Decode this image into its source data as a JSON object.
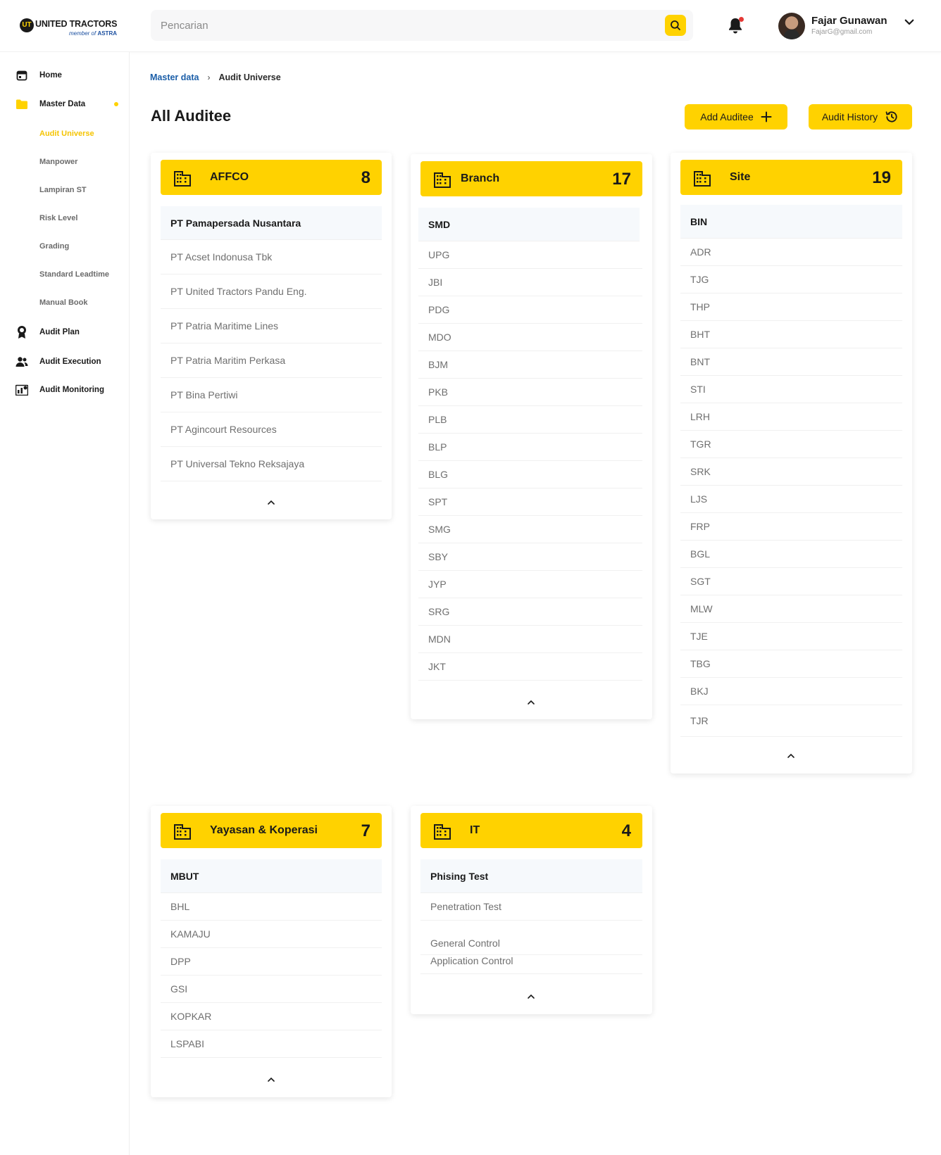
{
  "brand": {
    "badge": "UT",
    "name": "UNITED TRACTORS",
    "tagline_prefix": "member of",
    "tagline_brand": "ASTRA"
  },
  "search": {
    "placeholder": "Pencarian",
    "value": ""
  },
  "user": {
    "name": "Fajar Gunawan",
    "email": "FajarG@gmail.com"
  },
  "sidebar": {
    "items": [
      {
        "label": "Home",
        "icon": "calendar-icon"
      },
      {
        "label": "Master Data",
        "icon": "folder-icon"
      },
      {
        "label": "Audit Plan",
        "icon": "award-ribbon-icon"
      },
      {
        "label": "Audit Execution",
        "icon": "users-icon"
      },
      {
        "label": "Audit Monitoring",
        "icon": "monitoring-chart-icon"
      }
    ],
    "sub_items": [
      {
        "label": "Audit Universe",
        "active": true
      },
      {
        "label": "Manpower"
      },
      {
        "label": "Lampiran ST"
      },
      {
        "label": "Risk Level"
      },
      {
        "label": "Grading"
      },
      {
        "label": "Standard Leadtime"
      },
      {
        "label": "Manual Book"
      }
    ]
  },
  "breadcrumb": {
    "parent": "Master data",
    "separator": "›",
    "current": "Audit Universe"
  },
  "page": {
    "title": "All Auditee",
    "add_button": "Add Auditee",
    "history_button": "Audit History"
  },
  "cards": [
    {
      "title": "AFFCO",
      "count": "8",
      "items": [
        "PT Pamapersada Nusantara",
        "PT Acset Indonusa Tbk",
        "PT United Tractors Pandu Eng.",
        "PT Patria Maritime Lines",
        "PT Patria Maritim Perkasa",
        "PT Bina Pertiwi",
        "PT Agincourt Resources",
        "PT Universal Tekno Reksajaya"
      ]
    },
    {
      "title": "Branch",
      "count": "17",
      "items": [
        "SMD",
        "UPG",
        "JBI",
        "PDG",
        "MDO",
        "BJM",
        "PKB",
        "PLB",
        "BLP",
        "BLG",
        "SPT",
        "SMG",
        "SBY",
        "JYP",
        "SRG",
        "MDN",
        "JKT"
      ]
    },
    {
      "title": "Site",
      "count": "19",
      "items": [
        "BIN",
        "ADR",
        "TJG",
        "THP",
        "BHT",
        "BNT",
        "STI",
        "LRH",
        "TGR",
        "SRK",
        "LJS",
        "FRP",
        "BGL",
        "SGT",
        "MLW",
        "TJE",
        "TBG",
        "BKJ",
        "TJR"
      ]
    },
    {
      "title": "Yayasan & Koperasi",
      "count": "7",
      "items": [
        "MBUT",
        "BHL",
        "KAMAJU",
        "DPP",
        "GSI",
        "KOPKAR",
        "LSPABI"
      ]
    },
    {
      "title": "IT",
      "count": "4",
      "items": [
        "Phising Test",
        "Penetration Test",
        "General Control",
        "Application Control"
      ]
    }
  ],
  "colors": {
    "accent": "#ffd200",
    "link": "#1b5ea8",
    "active_sub": "#f5c400"
  }
}
